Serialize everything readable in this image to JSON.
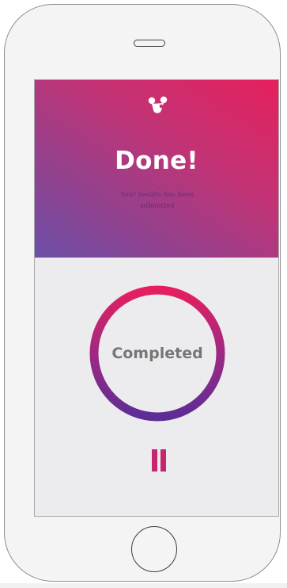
{
  "hero": {
    "title": "Done!",
    "subtitle": "Your results has been submitted",
    "gradient_colors": [
      "#6c4fa8",
      "#c23375",
      "#e6205d"
    ],
    "logo_icon": "paw-logo-icon"
  },
  "status": {
    "label": "Completed",
    "progress": 1.0,
    "ring_colors": [
      "#5d2d96",
      "#e61e5f"
    ]
  },
  "controls": {
    "pause_icon": "pause-icon",
    "accent_color": "#c6266f"
  }
}
